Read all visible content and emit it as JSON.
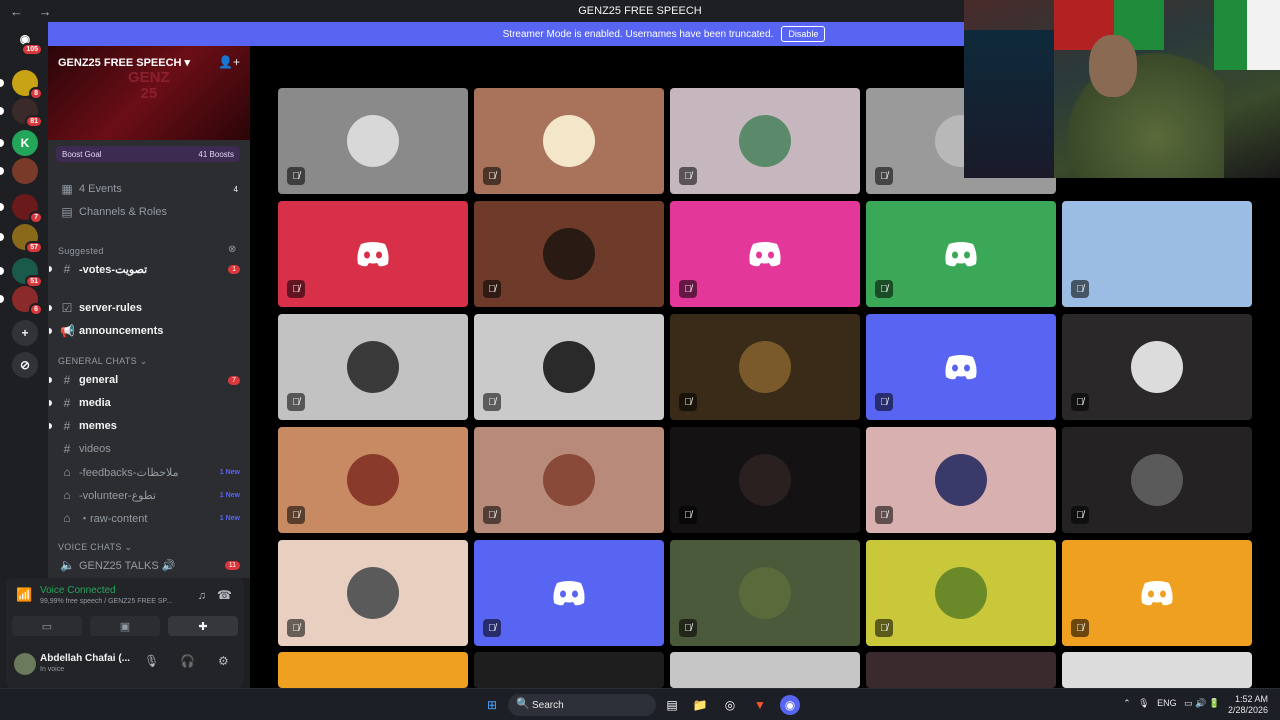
{
  "window": {
    "title": "GENZ25 FREE SPEECH",
    "back_icon": "arrow-left-icon",
    "forward_icon": "arrow-right-icon"
  },
  "banner": {
    "text": "Streamer Mode is enabled. Usernames have been truncated.",
    "disable_label": "Disable"
  },
  "rail": {
    "dm_badge": "105",
    "servers": [
      {
        "badge": "8",
        "color": "#c8a415"
      },
      {
        "badge": "81",
        "color": "#3a2a2a"
      },
      {
        "badge": "",
        "color": "#23a55a",
        "letter": "K"
      },
      {
        "badge": "",
        "color": "#7a3a2a"
      },
      {
        "badge": "7",
        "color": "#6a1a1a"
      },
      {
        "badge": "57",
        "color": "#8a6a1a"
      },
      {
        "badge": "51",
        "color": "#1a5a4a"
      },
      {
        "badge": "6",
        "color": "#8a2a2a"
      }
    ]
  },
  "server": {
    "name": "GENZ25 FREE SPEECH",
    "banner_art": "GENZ\n25",
    "boost_goal": "Boost Goal",
    "boost_count": "41 Boosts"
  },
  "channels": {
    "events": {
      "label": "4 Events",
      "count": "4"
    },
    "channels_roles": "Channels & Roles",
    "suggested_label": "Suggested",
    "suggested": {
      "label": "-votes-تصويت",
      "count": "1"
    },
    "top": [
      {
        "label": "server-rules"
      },
      {
        "label": "announcements"
      }
    ],
    "general_cat": "GENERAL CHATS",
    "general": [
      {
        "label": "general",
        "count": "7",
        "unread": true
      },
      {
        "label": "media",
        "unread": true
      },
      {
        "label": "memes",
        "unread": true
      },
      {
        "label": "videos",
        "unread": false
      },
      {
        "label": "-feedbacks-ملاحظات",
        "new": "1 New"
      },
      {
        "label": "-volunteer-تطوع",
        "new": "1 New"
      },
      {
        "label": "・raw-content",
        "new": "1 New"
      }
    ],
    "voice_cat": "VOICE CHATS",
    "voice": {
      "label": "GENZ25 TALKS 🔊",
      "count": "11"
    }
  },
  "voice_panel": {
    "status": "Voice Connected",
    "subtitle": "99,99% free speech / GENZ25 FREE SP..."
  },
  "user": {
    "name": "Abdellah Chafai (...",
    "status": "In voice"
  },
  "tiles": [
    {
      "bg": "#8a8a8a",
      "kind": "avatar",
      "av": "#d8d8d8"
    },
    {
      "bg": "#a8735a",
      "kind": "avatar",
      "av": "#f4e6c8"
    },
    {
      "bg": "#c6b7be",
      "kind": "avatar",
      "av": "#5a8a6a"
    },
    {
      "bg": "#9a9a9a",
      "kind": "avatar",
      "av": "#b8b8b8"
    },
    {
      "bg": "#000000",
      "kind": "none"
    },
    {
      "bg": "#d9304a",
      "kind": "discord"
    },
    {
      "bg": "#6e3a2a",
      "kind": "avatar",
      "av": "#2a1a14"
    },
    {
      "bg": "#e3379a",
      "kind": "discord"
    },
    {
      "bg": "#3aa856",
      "kind": "discord"
    },
    {
      "bg": "#9bbde3",
      "kind": "avatar",
      "av": "#9bbde3"
    },
    {
      "bg": "#c2c2c2",
      "kind": "avatar",
      "av": "#3a3a3a"
    },
    {
      "bg": "#cacaca",
      "kind": "avatar",
      "av": "#2a2a2a"
    },
    {
      "bg": "#3a2a18",
      "kind": "avatar",
      "av": "#7a5a2a"
    },
    {
      "bg": "#5865f2",
      "kind": "discord"
    },
    {
      "bg": "#2a2828",
      "kind": "avatar",
      "av": "#dcdcdc"
    },
    {
      "bg": "#c88a62",
      "kind": "avatar",
      "av": "#8a3a2a"
    },
    {
      "bg": "#b88a7a",
      "kind": "avatar",
      "av": "#8a4a3a"
    },
    {
      "bg": "#141212",
      "kind": "avatar",
      "av": "#2a2020"
    },
    {
      "bg": "#d8b0b0",
      "kind": "avatar",
      "av": "#3a3a6a"
    },
    {
      "bg": "#242222",
      "kind": "avatar",
      "av": "#5a5a5a"
    },
    {
      "bg": "#e8cfc0",
      "kind": "avatar",
      "av": "#5a5a5a"
    },
    {
      "bg": "#5865f2",
      "kind": "discord"
    },
    {
      "bg": "#4a5a3a",
      "kind": "avatar",
      "av": "#5a6a3a"
    },
    {
      "bg": "#c8c83a",
      "kind": "avatar",
      "av": "#6a8a2a"
    },
    {
      "bg": "#f0a020",
      "kind": "discord"
    },
    {
      "bg": "#f0a020",
      "kind": "partial"
    },
    {
      "bg": "#1e1e1e",
      "kind": "partial"
    },
    {
      "bg": "#c6c6c6",
      "kind": "partial"
    },
    {
      "bg": "#3a2a2e",
      "kind": "partial"
    },
    {
      "bg": "#dcdcdc",
      "kind": "partial"
    }
  ],
  "taskbar": {
    "search": "Search",
    "lang": "ENG",
    "time": "1:52 AM",
    "date": "2/28/2026"
  }
}
